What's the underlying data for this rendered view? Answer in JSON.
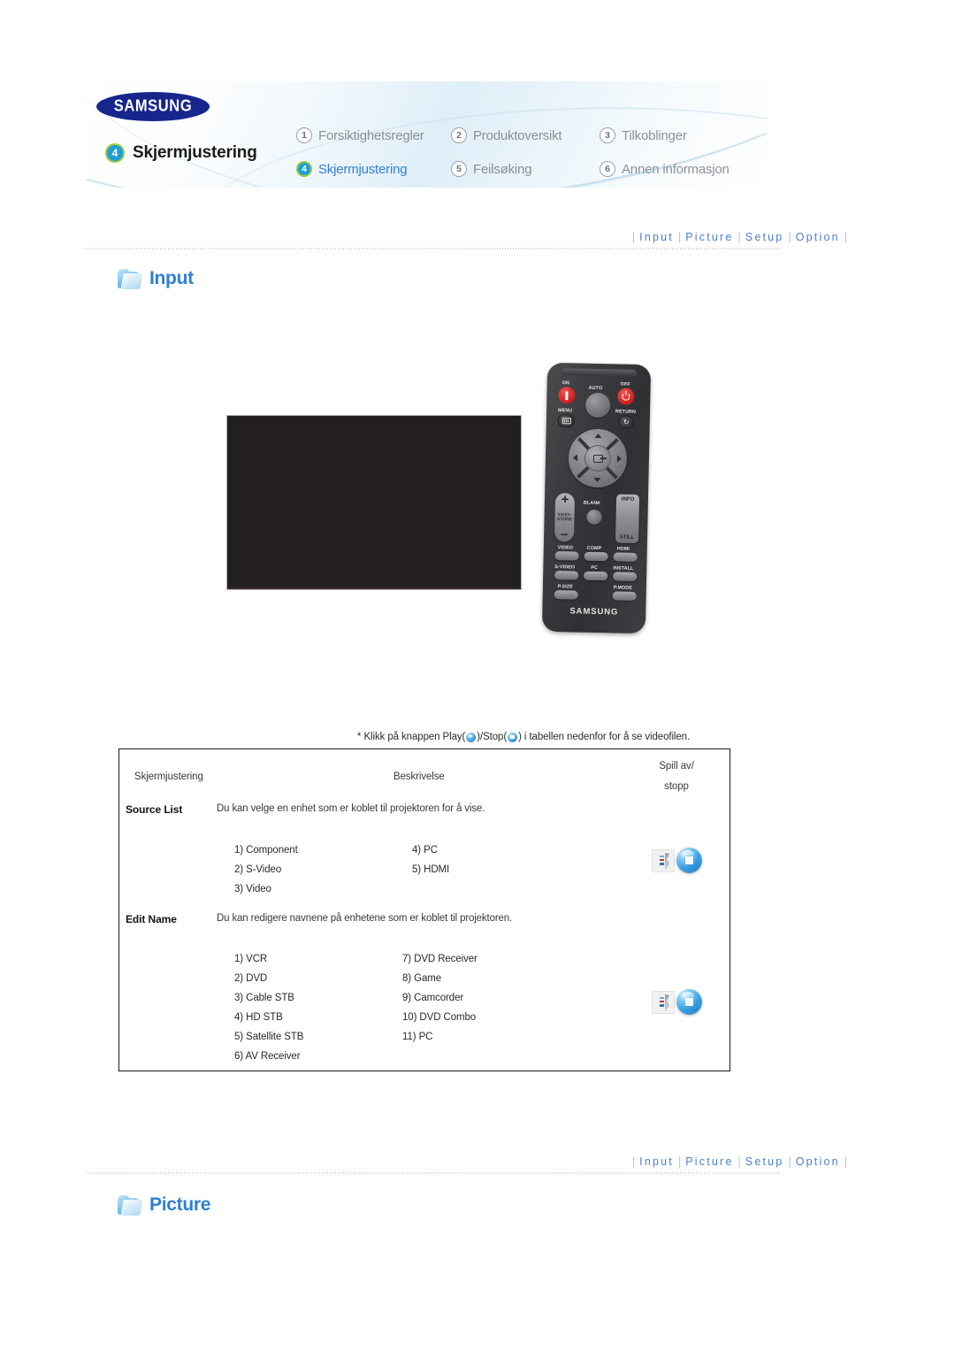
{
  "header": {
    "brand": "SAMSUNG",
    "current_section": {
      "number": "4",
      "label": "Skjermjustering"
    },
    "nav_items": [
      {
        "number": "1",
        "label": "Forsiktighetsregler",
        "active": false
      },
      {
        "number": "2",
        "label": "Produktoversikt",
        "active": false
      },
      {
        "number": "3",
        "label": "Tilkoblinger",
        "active": false
      },
      {
        "number": "4",
        "label": "Skjermjustering",
        "active": true
      },
      {
        "number": "5",
        "label": "Feilsøking",
        "active": false
      },
      {
        "number": "6",
        "label": "Annen informasjon",
        "active": false
      }
    ]
  },
  "subnav": {
    "items": [
      "Input",
      "Picture",
      "Setup",
      "Option"
    ],
    "separator": "|"
  },
  "sections": {
    "input": {
      "title": "Input",
      "icon": "folder-icon"
    },
    "picture": {
      "title": "Picture",
      "icon": "folder-icon"
    }
  },
  "note": {
    "prefix": "* Klikk på knappen Play(",
    "middle": ")/Stop(",
    "suffix": ") i tabellen nedenfor for å se videofilen."
  },
  "remote": {
    "brand": "SAMSUNG",
    "labels": {
      "on": "ON",
      "off": "OFF",
      "auto": "AUTO",
      "menu": "MENU",
      "return": "RETURN",
      "keystone": "V.KEY-STONE",
      "blank": "BLANK",
      "info": "INFO",
      "still": "STILL",
      "video": "VIDEO",
      "comp": "COMP",
      "hdmi": "HDMI",
      "svideo": "S-VIDEO",
      "pc": "PC",
      "install": "INSTALL",
      "psize": "P.SIZE",
      "pmode": "P.MODE"
    }
  },
  "table": {
    "headers": {
      "col1": "Skjermjustering",
      "col2": "Beskrivelse",
      "col3_line1": "Spill av/",
      "col3_line2": "stopp"
    },
    "rows": [
      {
        "name": "Source List",
        "description": "Du kan velge en enhet som er koblet til projektoren for å vise.",
        "options_left": [
          "1) Component",
          "2) S-Video",
          "3) Video"
        ],
        "options_right": [
          "4) PC",
          "5) HDMI"
        ],
        "control": "stop-button"
      },
      {
        "name": "Edit Name",
        "description": "Du kan redigere navnene på enhetene som er koblet til projektoren.",
        "options_left": [
          "1) VCR",
          "2) DVD",
          "3) Cable STB",
          "4) HD STB",
          "5) Satellite STB",
          "6) AV Receiver"
        ],
        "options_right": [
          "7) DVD Receiver",
          "8) Game",
          "9) Camcorder",
          "10) DVD Combo",
          "11) PC"
        ],
        "control": "stop-button"
      }
    ]
  },
  "colors": {
    "accent_blue": "#2f7fd4",
    "link_blue": "#4a7fd4",
    "badge_blue": "#1d9ed9",
    "badge_ring_green": "#9ccb3b",
    "samsung_navy": "#16268c",
    "video_black": "#231f20"
  }
}
